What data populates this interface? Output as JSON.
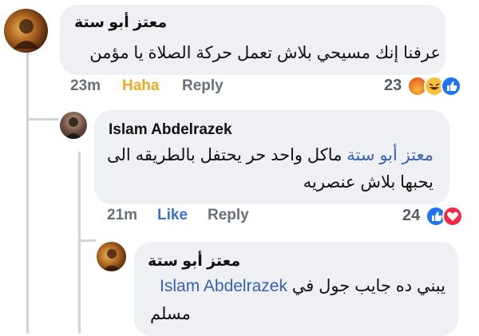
{
  "comment1": {
    "author": "معتز أبو ستة",
    "text": "عرفنا إنك مسيحي بلاش تعمل حركة الصلاة يا مؤمن",
    "time": "23m",
    "reaction_label": "Haha",
    "reply_label": "Reply",
    "reaction_count": "23",
    "reactions": [
      "angry-icon",
      "haha-icon",
      "like-icon"
    ]
  },
  "reply1": {
    "author": "Islam Abdelrazek",
    "mention": "معتز أبو ستة",
    "text_line1": "ماكل واحد حر يحتفل بالطريقه الى",
    "text_line2": "يحبها بلاش عنصريه",
    "time": "21m",
    "like_label": "Like",
    "reply_label": "Reply",
    "reaction_count": "24",
    "reactions": [
      "like-icon",
      "love-icon"
    ]
  },
  "reply2": {
    "author": "معتز أبو ستة",
    "mention": "Islam Abdelrazek",
    "text_line1": "يبني ده جايب جول في",
    "text_line2": "مسلم"
  },
  "colors": {
    "bubble": "#eef0f3",
    "mention": "#3861b5",
    "haha": "#e8ac24",
    "like": "#3d6fd0"
  }
}
